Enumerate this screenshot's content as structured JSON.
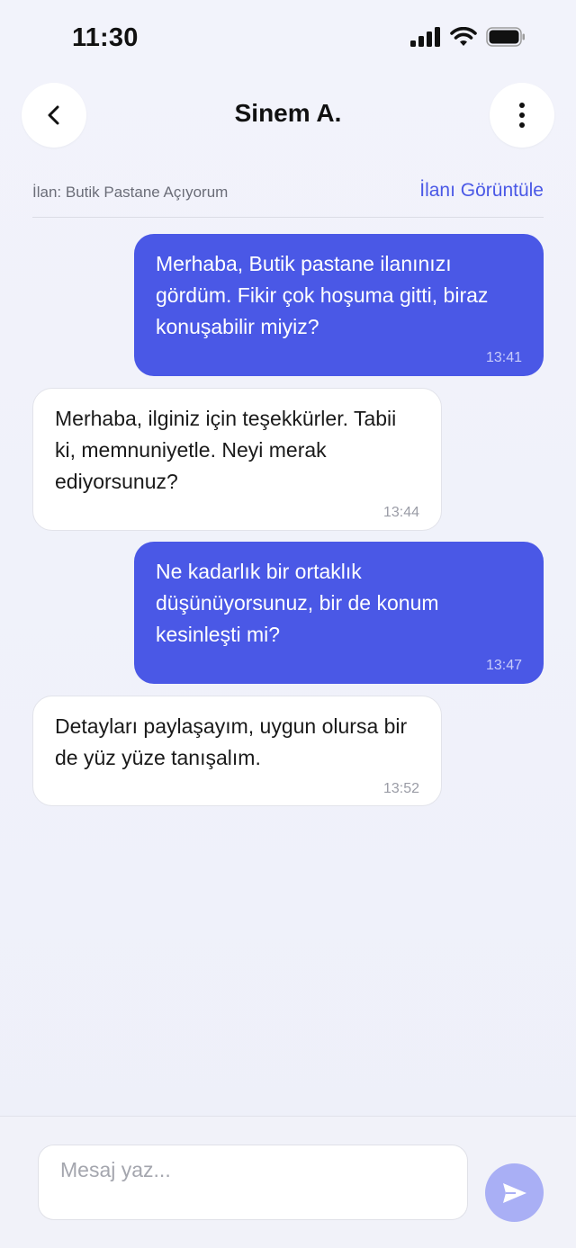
{
  "status_bar": {
    "time": "11:30",
    "icons": [
      "signal-icon",
      "wifi-icon",
      "battery-icon"
    ]
  },
  "header": {
    "title": "Sinem A.",
    "back_icon": "chevron-left-icon",
    "more_icon": "more-vertical-icon"
  },
  "listing": {
    "label": "İlan: Butik Pastane Açıyorum",
    "link_label": "İlanı Görüntüle"
  },
  "messages": [
    {
      "direction": "outgoing",
      "text": "Merhaba, Butik pastane ilanınızı gördüm. Fikir çok hoşuma gitti, biraz konuşabilir miyiz?",
      "time": "13:41"
    },
    {
      "direction": "incoming",
      "text": "Merhaba, ilginiz için teşekkürler. Tabii ki, memnuniyetle. Neyi merak ediyorsunuz?",
      "time": "13:44"
    },
    {
      "direction": "outgoing",
      "text": "Ne kadarlık bir ortaklık düşünüyorsunuz, bir de konum kesinleşti mi?",
      "time": "13:47"
    },
    {
      "direction": "incoming",
      "text": "Detayları paylaşayım, uygun olursa bir de yüz yüze tanışalım.",
      "time": "13:52"
    }
  ],
  "composer": {
    "placeholder": "Mesaj yaz...",
    "value": "",
    "send_icon": "send-icon"
  },
  "colors": {
    "accent": "#4a58e6",
    "send_disabled": "#a9aff5",
    "background": "#f2f3fb",
    "incoming_bubble": "#ffffff"
  }
}
